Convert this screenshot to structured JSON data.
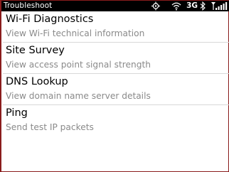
{
  "statusbar": {
    "title": "Troubleshoot",
    "network": "3G",
    "icons": [
      "gps-icon",
      "wifi-signal-icon",
      "bluetooth-icon",
      "cell-signal-icon"
    ]
  },
  "menu": {
    "items": [
      {
        "title": "Wi-Fi Diagnostics",
        "subtitle": "View Wi-Fi technical information"
      },
      {
        "title": "Site Survey",
        "subtitle": "View access point signal strength"
      },
      {
        "title": "DNS Lookup",
        "subtitle": "View domain name server details"
      },
      {
        "title": "Ping",
        "subtitle": "Send test IP packets"
      }
    ]
  },
  "colors": {
    "statusbar_bg": "#000000",
    "frame_border": "#8a1c1c",
    "subtitle_text": "#8a8a8a"
  }
}
